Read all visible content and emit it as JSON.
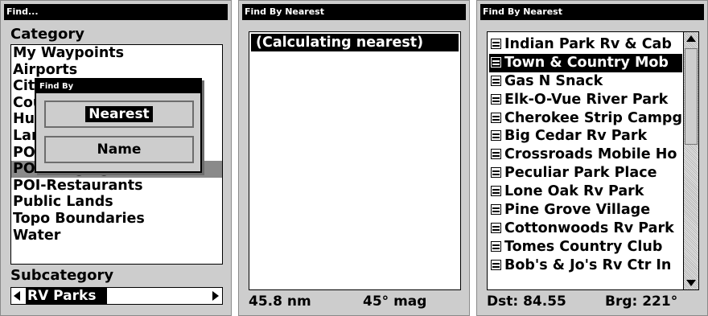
{
  "screen1": {
    "title": "Find...",
    "category_label": "Category",
    "categories": [
      "My Waypoints",
      "Airports",
      "Cities",
      "Countries",
      "Hunting",
      "Landmarks",
      "POI-All Others",
      "POI-Lodging",
      "POI-Restaurants",
      "Public Lands",
      "Topo Boundaries",
      "Water"
    ],
    "selected_category": "POI-Lodging",
    "subcategory_label": "Subcategory",
    "subcategory_value": "RV Parks",
    "popup": {
      "title": "Find By",
      "nearest_label": "Nearest",
      "name_label": "Name"
    }
  },
  "screen2": {
    "title": "Find By Nearest",
    "message": "(Calculating nearest)",
    "distance": "45.8 nm",
    "bearing": "45° mag"
  },
  "screen3": {
    "title": "Find By Nearest",
    "items": [
      "Indian Park Rv & Cab",
      "Town & Country Mob",
      "Gas N Snack",
      "Elk-O-Vue River Park",
      "Cherokee Strip Campg",
      "Big Cedar Rv Park",
      "Crossroads Mobile Ho",
      "Peculiar Park Place",
      "Lone Oak Rv Park",
      "Pine Grove Village",
      "Cottonwoods Rv Park",
      "Tomes Country Club",
      "Bob's & Jo's Rv Ctr In"
    ],
    "selected_item": "Town & Country Mob",
    "distance": "Dst: 84.55",
    "bearing": "Brg: 221°"
  }
}
